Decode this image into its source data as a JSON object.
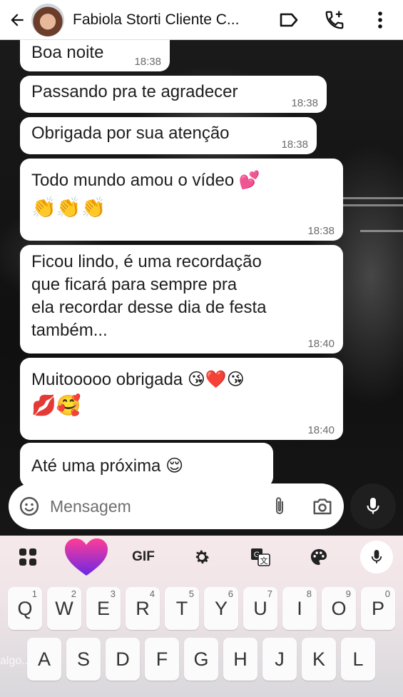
{
  "header": {
    "back_icon": "arrow-left-icon",
    "contact_name": "Fabiola Storti Cliente C...",
    "icons": [
      "label-icon",
      "add-call-icon",
      "more-vert-icon"
    ]
  },
  "messages": [
    {
      "text": "Boa noite",
      "time": "18:38"
    },
    {
      "text": "Passando pra te agradecer",
      "time": "18:38"
    },
    {
      "text": "Obrigada por sua atenção",
      "time": "18:38"
    },
    {
      "text": "Todo mundo amou o vídeo",
      "emoji_inline": "💕",
      "emoji_line": "👏👏👏",
      "time": "18:38"
    },
    {
      "lines": [
        "Ficou lindo, é uma recordação",
        "que ficará para sempre pra",
        "ela  recordar desse dia de festa",
        "também..."
      ],
      "time": "18:40"
    },
    {
      "text": "Muitooooo obrigada",
      "emoji_inline": "😘❤️😘",
      "emoji_line": "💋🥰",
      "time": "18:40"
    },
    {
      "text": "Até uma próxima",
      "emoji_inline": "😌"
    }
  ],
  "composer": {
    "placeholder": "Mensagem",
    "icons": [
      "emoji-sticker-icon",
      "attach-icon",
      "camera-icon",
      "mic-icon"
    ]
  },
  "keyboard": {
    "toolbar": {
      "gif_label": "GIF",
      "icons": [
        "apps-grid-icon",
        "heart-icon",
        "settings-icon",
        "translate-icon",
        "palette-icon",
        "mic-icon"
      ]
    },
    "row1": [
      {
        "k": "Q",
        "n": "1"
      },
      {
        "k": "W",
        "n": "2"
      },
      {
        "k": "E",
        "n": "3"
      },
      {
        "k": "R",
        "n": "4"
      },
      {
        "k": "T",
        "n": "5"
      },
      {
        "k": "Y",
        "n": "6"
      },
      {
        "k": "U",
        "n": "7"
      },
      {
        "k": "I",
        "n": "8"
      },
      {
        "k": "O",
        "n": "9"
      },
      {
        "k": "P",
        "n": "0"
      }
    ],
    "row2": [
      "A",
      "S",
      "D",
      "F",
      "G",
      "H",
      "J",
      "K",
      "L"
    ]
  },
  "overlay_text": "algo..."
}
